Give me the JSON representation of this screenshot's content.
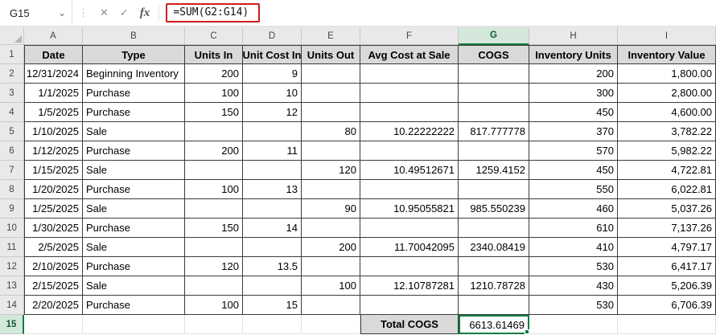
{
  "formula_bar": {
    "name_box": "G15",
    "cancel_icon": "✕",
    "enter_icon": "✓",
    "fx_label": "fx",
    "formula": "=SUM(G2:G14)"
  },
  "colors": {
    "selection_green": "#107c41",
    "annotation_red": "#cf1d1d",
    "header_row_fill": "#d9d9d9",
    "gutter_fill": "#e9e9e9"
  },
  "grid": {
    "selected_cell": "G15",
    "column_letters": [
      "A",
      "B",
      "C",
      "D",
      "E",
      "F",
      "G",
      "H",
      "I"
    ],
    "rows": [
      [
        "Date",
        "Type",
        "Units In",
        "Unit Cost In",
        "Units Out",
        "Avg Cost at Sale",
        "COGS",
        "Inventory Units",
        "Inventory Value"
      ],
      [
        "12/31/2024",
        "Beginning Inventory",
        "200",
        "9",
        "",
        "",
        "",
        "200",
        "1,800.00"
      ],
      [
        "1/1/2025",
        "Purchase",
        "100",
        "10",
        "",
        "",
        "",
        "300",
        "2,800.00"
      ],
      [
        "1/5/2025",
        "Purchase",
        "150",
        "12",
        "",
        "",
        "",
        "450",
        "4,600.00"
      ],
      [
        "1/10/2025",
        "Sale",
        "",
        "",
        "80",
        "10.22222222",
        "817.777778",
        "370",
        "3,782.22"
      ],
      [
        "1/12/2025",
        "Purchase",
        "200",
        "11",
        "",
        "",
        "",
        "570",
        "5,982.22"
      ],
      [
        "1/15/2025",
        "Sale",
        "",
        "",
        "120",
        "10.49512671",
        "1259.4152",
        "450",
        "4,722.81"
      ],
      [
        "1/20/2025",
        "Purchase",
        "100",
        "13",
        "",
        "",
        "",
        "550",
        "6,022.81"
      ],
      [
        "1/25/2025",
        "Sale",
        "",
        "",
        "90",
        "10.95055821",
        "985.550239",
        "460",
        "5,037.26"
      ],
      [
        "1/30/2025",
        "Purchase",
        "150",
        "14",
        "",
        "",
        "",
        "610",
        "7,137.26"
      ],
      [
        "2/5/2025",
        "Sale",
        "",
        "",
        "200",
        "11.70042095",
        "2340.08419",
        "410",
        "4,797.17"
      ],
      [
        "2/10/2025",
        "Purchase",
        "120",
        "13.5",
        "",
        "",
        "",
        "530",
        "6,417.17"
      ],
      [
        "2/15/2025",
        "Sale",
        "",
        "",
        "100",
        "12.10787281",
        "1210.78728",
        "430",
        "5,206.39"
      ],
      [
        "2/20/2025",
        "Purchase",
        "100",
        "15",
        "",
        "",
        "",
        "530",
        "6,706.39"
      ],
      [
        "",
        "",
        "",
        "",
        "",
        "Total COGS",
        "6613.61469",
        "",
        ""
      ]
    ]
  }
}
